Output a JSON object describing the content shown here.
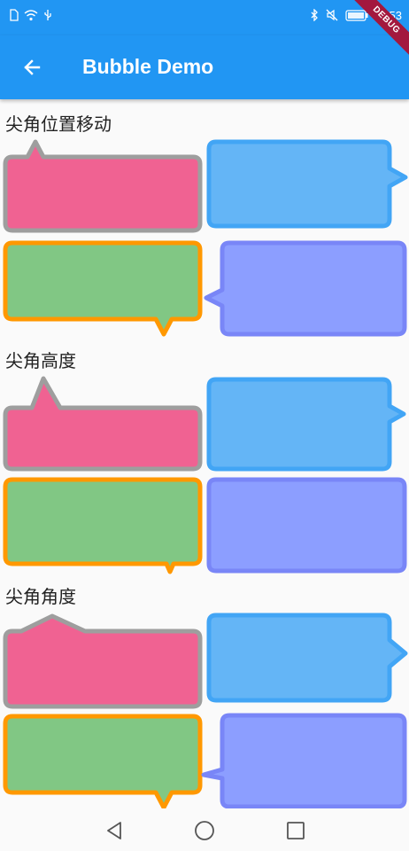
{
  "status_bar": {
    "time": "3:53",
    "icons": [
      "sim-icon",
      "wifi-icon",
      "usb-icon",
      "bluetooth-icon",
      "mute-icon",
      "battery-icon"
    ]
  },
  "app_bar": {
    "title": "Bubble Demo",
    "back_icon": "arrow-left-icon",
    "debug_banner": "DEBUG",
    "color": "#2196f3"
  },
  "sections": [
    {
      "title": "尖角位置移动"
    },
    {
      "title": "尖角高度"
    },
    {
      "title": "尖角角度"
    }
  ],
  "colors": {
    "pink_fill": "#f06292",
    "pink_border": "#9e9e9e",
    "blue_fill": "#64b5f6",
    "blue_border": "#42a5f5",
    "green_fill": "#81c784",
    "green_border": "#ff9800",
    "indigo_fill": "#8c9eff",
    "indigo_border": "#7986f7"
  },
  "nav_bar": {
    "buttons": [
      "back-triangle-icon",
      "home-circle-icon",
      "recents-square-icon"
    ]
  }
}
